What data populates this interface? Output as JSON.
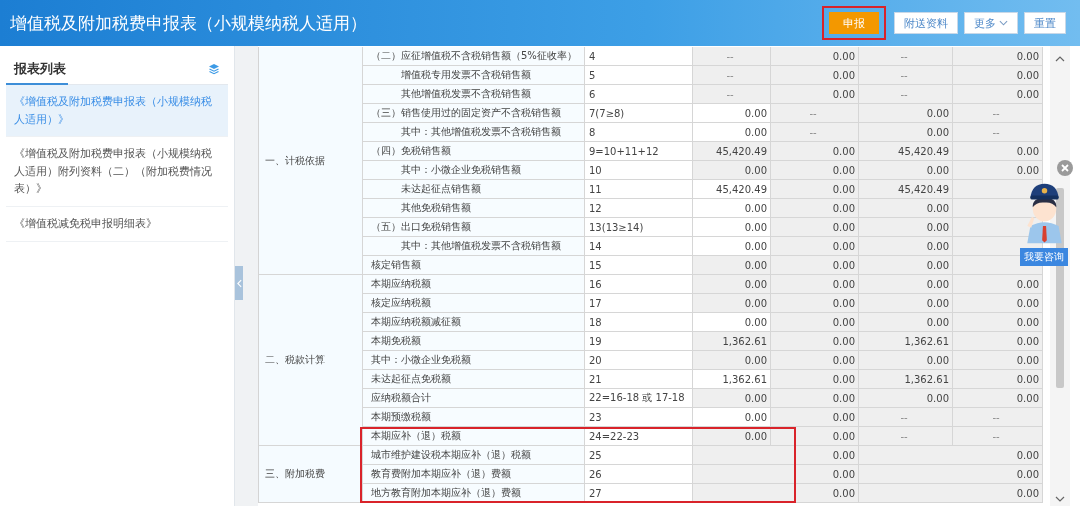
{
  "header": {
    "title": "增值税及附加税费申报表（小规模纳税人适用）",
    "buttons": [
      {
        "label": "申报",
        "kind": "primary",
        "highlighted": true
      },
      {
        "label": "附送资料",
        "kind": "plain",
        "highlighted": false
      },
      {
        "label": "更多",
        "kind": "dropdown",
        "highlighted": false
      },
      {
        "label": "重置",
        "kind": "plain",
        "highlighted": false
      }
    ]
  },
  "sidebar": {
    "title": "报表列表",
    "items": [
      {
        "label": "《增值税及附加税费申报表（小规模纳税人适用）》",
        "selected": true
      },
      {
        "label": "《增值税及附加税费申报表（小规模纳税人适用）附列资料（二）（附加税费情况表）》",
        "selected": false
      },
      {
        "label": "《增值税减免税申报明细表》",
        "selected": false
      }
    ]
  },
  "assistant": {
    "label": "我要咨询"
  },
  "table": {
    "sections": [
      {
        "label": "一、计税依据",
        "rows": [
          {
            "item": "（二）应征增值税不含税销售额（5%征收率）",
            "number": "4",
            "highlighted": false,
            "cells": [
              {
                "value": "--",
                "kind": "dash"
              },
              {
                "value": "0.00",
                "kind": "readonly"
              },
              {
                "value": "--",
                "kind": "dash"
              },
              {
                "value": "0.00",
                "kind": "readonly"
              }
            ],
            "children": [
              {
                "item": "增值税专用发票不含税销售额",
                "number": "5",
                "highlighted": false,
                "cells": [
                  {
                    "value": "--",
                    "kind": "dash"
                  },
                  {
                    "value": "0.00",
                    "kind": "readonly"
                  },
                  {
                    "value": "--",
                    "kind": "dash"
                  },
                  {
                    "value": "0.00",
                    "kind": "readonly"
                  }
                ]
              },
              {
                "item": "其他增值税发票不含税销售额",
                "number": "6",
                "highlighted": false,
                "cells": [
                  {
                    "value": "--",
                    "kind": "dash"
                  },
                  {
                    "value": "0.00",
                    "kind": "readonly"
                  },
                  {
                    "value": "--",
                    "kind": "dash"
                  },
                  {
                    "value": "0.00",
                    "kind": "readonly"
                  }
                ]
              }
            ]
          },
          {
            "item": "（三）销售使用过的固定资产不含税销售额",
            "number": "7(7≥8)",
            "highlighted": false,
            "cells": [
              {
                "value": "0.00",
                "kind": "input"
              },
              {
                "value": "--",
                "kind": "dash"
              },
              {
                "value": "0.00",
                "kind": "readonly"
              },
              {
                "value": "--",
                "kind": "dash"
              }
            ],
            "children": [
              {
                "item": "其中：其他增值税发票不含税销售额",
                "number": "8",
                "highlighted": false,
                "cells": [
                  {
                    "value": "0.00",
                    "kind": "input"
                  },
                  {
                    "value": "--",
                    "kind": "dash"
                  },
                  {
                    "value": "0.00",
                    "kind": "readonly"
                  },
                  {
                    "value": "--",
                    "kind": "dash"
                  }
                ]
              }
            ]
          },
          {
            "item": "（四）免税销售额",
            "number": "9=10+11+12",
            "highlighted": false,
            "cells": [
              {
                "value": "45,420.49",
                "kind": "readonly"
              },
              {
                "value": "0.00",
                "kind": "readonly"
              },
              {
                "value": "45,420.49",
                "kind": "readonly"
              },
              {
                "value": "0.00",
                "kind": "readonly"
              }
            ],
            "children": [
              {
                "item": "其中：小微企业免税销售额",
                "number": "10",
                "highlighted": false,
                "cells": [
                  {
                    "value": "0.00",
                    "kind": "readonly"
                  },
                  {
                    "value": "0.00",
                    "kind": "readonly"
                  },
                  {
                    "value": "0.00",
                    "kind": "readonly"
                  },
                  {
                    "value": "0.00",
                    "kind": "readonly"
                  }
                ]
              },
              {
                "item": "未达起征点销售额",
                "number": "11",
                "highlighted": false,
                "cells": [
                  {
                    "value": "45,420.49",
                    "kind": "input"
                  },
                  {
                    "value": "0.00",
                    "kind": "readonly"
                  },
                  {
                    "value": "45,420.49",
                    "kind": "readonly"
                  },
                  {
                    "kind": "readonly"
                  }
                ]
              },
              {
                "item": "其他免税销售额",
                "number": "12",
                "highlighted": false,
                "cells": [
                  {
                    "value": "0.00",
                    "kind": "input"
                  },
                  {
                    "value": "0.00",
                    "kind": "readonly"
                  },
                  {
                    "value": "0.00",
                    "kind": "readonly"
                  },
                  {
                    "kind": "readonly"
                  }
                ]
              }
            ]
          },
          {
            "item": "（五）出口免税销售额",
            "number": "13(13≥14)",
            "highlighted": false,
            "cells": [
              {
                "value": "0.00",
                "kind": "input"
              },
              {
                "value": "0.00",
                "kind": "readonly"
              },
              {
                "value": "0.00",
                "kind": "readonly"
              },
              {
                "kind": "readonly"
              }
            ],
            "children": [
              {
                "item": "其中：其他增值税发票不含税销售额",
                "number": "14",
                "highlighted": false,
                "cells": [
                  {
                    "value": "0.00",
                    "kind": "input"
                  },
                  {
                    "value": "0.00",
                    "kind": "readonly"
                  },
                  {
                    "value": "0.00",
                    "kind": "readonly"
                  },
                  {
                    "kind": "readonly"
                  }
                ]
              }
            ]
          },
          {
            "item": "核定销售额",
            "number": "15",
            "highlighted": false,
            "cells": [
              {
                "value": "0.00",
                "kind": "readonly"
              },
              {
                "value": "0.00",
                "kind": "readonly"
              },
              {
                "value": "0.00",
                "kind": "readonly"
              },
              {
                "kind": "readonly"
              }
            ]
          }
        ]
      },
      {
        "label": "二、税款计算",
        "rows": [
          {
            "item": "本期应纳税额",
            "number": "16",
            "highlighted": false,
            "cells": [
              {
                "value": "0.00",
                "kind": "readonly"
              },
              {
                "value": "0.00",
                "kind": "readonly"
              },
              {
                "value": "0.00",
                "kind": "readonly"
              },
              {
                "value": "0.00",
                "kind": "readonly"
              }
            ]
          },
          {
            "item": "核定应纳税额",
            "number": "17",
            "highlighted": false,
            "cells": [
              {
                "value": "0.00",
                "kind": "readonly"
              },
              {
                "value": "0.00",
                "kind": "readonly"
              },
              {
                "value": "0.00",
                "kind": "readonly"
              },
              {
                "value": "0.00",
                "kind": "readonly"
              }
            ]
          },
          {
            "item": "本期应纳税额减征额",
            "number": "18",
            "highlighted": false,
            "cells": [
              {
                "value": "0.00",
                "kind": "input"
              },
              {
                "value": "0.00",
                "kind": "readonly"
              },
              {
                "value": "0.00",
                "kind": "readonly"
              },
              {
                "value": "0.00",
                "kind": "readonly"
              }
            ]
          },
          {
            "item": "本期免税额",
            "number": "19",
            "highlighted": false,
            "cells": [
              {
                "value": "1,362.61",
                "kind": "readonly"
              },
              {
                "value": "0.00",
                "kind": "readonly"
              },
              {
                "value": "1,362.61",
                "kind": "readonly"
              },
              {
                "value": "0.00",
                "kind": "readonly"
              }
            ]
          },
          {
            "item": "其中：小微企业免税额",
            "number": "20",
            "highlighted": false,
            "cells": [
              {
                "value": "0.00",
                "kind": "readonly"
              },
              {
                "value": "0.00",
                "kind": "readonly"
              },
              {
                "value": "0.00",
                "kind": "readonly"
              },
              {
                "value": "0.00",
                "kind": "readonly"
              }
            ]
          },
          {
            "item": "未达起征点免税额",
            "number": "21",
            "highlighted": false,
            "cells": [
              {
                "value": "1,362.61",
                "kind": "input"
              },
              {
                "value": "0.00",
                "kind": "readonly"
              },
              {
                "value": "1,362.61",
                "kind": "readonly"
              },
              {
                "value": "0.00",
                "kind": "readonly"
              }
            ]
          },
          {
            "item": "应纳税额合计",
            "number": "22=16-18 或 17-18",
            "highlighted": false,
            "cells": [
              {
                "value": "0.00",
                "kind": "readonly"
              },
              {
                "value": "0.00",
                "kind": "readonly"
              },
              {
                "value": "0.00",
                "kind": "readonly"
              },
              {
                "value": "0.00",
                "kind": "readonly"
              }
            ]
          },
          {
            "item": "本期预缴税额",
            "number": "23",
            "highlighted": false,
            "cells": [
              {
                "value": "0.00",
                "kind": "input"
              },
              {
                "value": "0.00",
                "kind": "readonly"
              },
              {
                "value": "--",
                "kind": "dash"
              },
              {
                "value": "--",
                "kind": "dash"
              }
            ]
          },
          {
            "item": "本期应补（退）税额",
            "number": "24=22-23",
            "highlighted": true,
            "cells": [
              {
                "value": "0.00",
                "kind": "readonly"
              },
              {
                "value": "0.00",
                "kind": "readonly"
              },
              {
                "value": "--",
                "kind": "dash"
              },
              {
                "value": "--",
                "kind": "dash"
              }
            ]
          }
        ]
      },
      {
        "label": "三、附加税费",
        "rows": [
          {
            "item": "城市维护建设税本期应补（退）税额",
            "number": "25",
            "highlighted": true,
            "cells": [
              {
                "value": "0.00",
                "kind": "merged"
              },
              {
                "value": "0.00",
                "kind": "merged"
              }
            ]
          },
          {
            "item": "教育费附加本期应补（退）费额",
            "number": "26",
            "highlighted": true,
            "cells": [
              {
                "value": "0.00",
                "kind": "merged"
              },
              {
                "value": "0.00",
                "kind": "merged"
              }
            ]
          },
          {
            "item": "地方教育附加本期应补（退）费额",
            "number": "27",
            "highlighted": true,
            "cells": [
              {
                "value": "0.00",
                "kind": "merged"
              },
              {
                "value": "0.00",
                "kind": "merged"
              }
            ]
          }
        ]
      }
    ]
  }
}
